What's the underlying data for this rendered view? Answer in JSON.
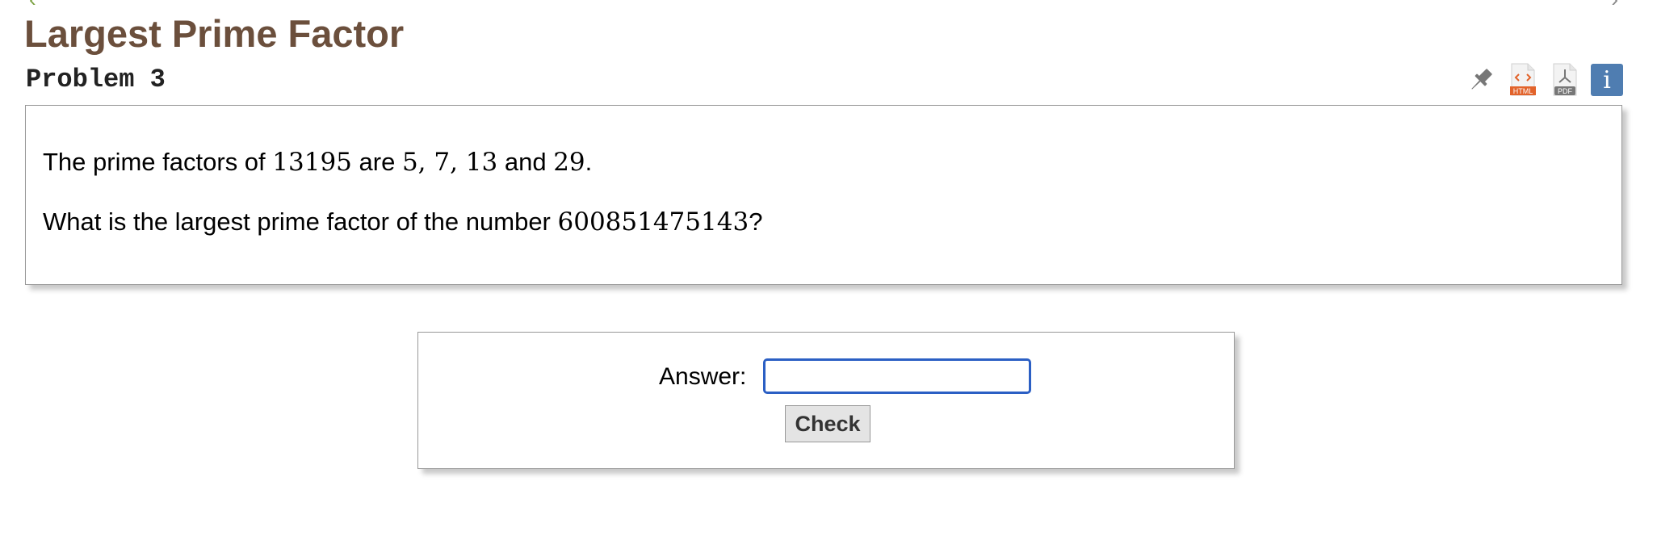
{
  "header": {
    "title": "Largest Prime Factor",
    "subtitle": "Problem 3"
  },
  "toolbar": {
    "icons": [
      "pin-icon",
      "html-icon",
      "pdf-icon",
      "info-icon"
    ],
    "html_badge": "HTML",
    "pdf_badge": "PDF",
    "info_glyph": "i"
  },
  "problem": {
    "line1_prefix": "The prime factors of ",
    "line1_number": "13195",
    "line1_mid": " are ",
    "line1_factors": "5, 7, 13",
    "line1_and": " and ",
    "line1_last": "29",
    "line1_end": ".",
    "line2_prefix": "What is the largest prime factor of the number ",
    "line2_number": "600851475143",
    "line2_end": "?"
  },
  "answer": {
    "label": "Answer:",
    "value": "",
    "check_label": "Check"
  },
  "colors": {
    "title": "#6b4f3c",
    "info_bg": "#4f7db1",
    "input_border": "#2b5fc4"
  }
}
